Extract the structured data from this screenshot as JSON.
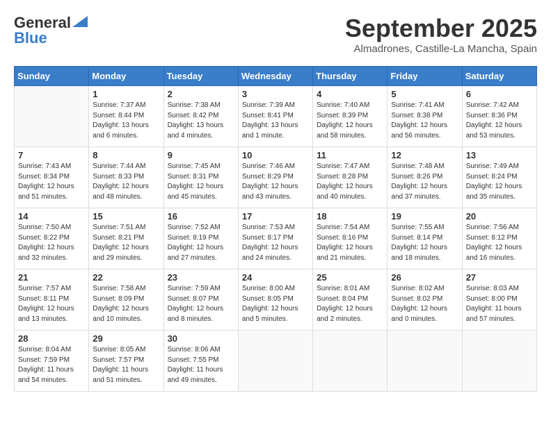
{
  "header": {
    "logo_line1": "General",
    "logo_line2": "Blue",
    "month": "September 2025",
    "location": "Almadrones, Castille-La Mancha, Spain"
  },
  "weekdays": [
    "Sunday",
    "Monday",
    "Tuesday",
    "Wednesday",
    "Thursday",
    "Friday",
    "Saturday"
  ],
  "weeks": [
    [
      {
        "day": "",
        "info": ""
      },
      {
        "day": "1",
        "info": "Sunrise: 7:37 AM\nSunset: 8:44 PM\nDaylight: 13 hours\nand 6 minutes."
      },
      {
        "day": "2",
        "info": "Sunrise: 7:38 AM\nSunset: 8:42 PM\nDaylight: 13 hours\nand 4 minutes."
      },
      {
        "day": "3",
        "info": "Sunrise: 7:39 AM\nSunset: 8:41 PM\nDaylight: 13 hours\nand 1 minute."
      },
      {
        "day": "4",
        "info": "Sunrise: 7:40 AM\nSunset: 8:39 PM\nDaylight: 12 hours\nand 58 minutes."
      },
      {
        "day": "5",
        "info": "Sunrise: 7:41 AM\nSunset: 8:38 PM\nDaylight: 12 hours\nand 56 minutes."
      },
      {
        "day": "6",
        "info": "Sunrise: 7:42 AM\nSunset: 8:36 PM\nDaylight: 12 hours\nand 53 minutes."
      }
    ],
    [
      {
        "day": "7",
        "info": "Sunrise: 7:43 AM\nSunset: 8:34 PM\nDaylight: 12 hours\nand 51 minutes."
      },
      {
        "day": "8",
        "info": "Sunrise: 7:44 AM\nSunset: 8:33 PM\nDaylight: 12 hours\nand 48 minutes."
      },
      {
        "day": "9",
        "info": "Sunrise: 7:45 AM\nSunset: 8:31 PM\nDaylight: 12 hours\nand 45 minutes."
      },
      {
        "day": "10",
        "info": "Sunrise: 7:46 AM\nSunset: 8:29 PM\nDaylight: 12 hours\nand 43 minutes."
      },
      {
        "day": "11",
        "info": "Sunrise: 7:47 AM\nSunset: 8:28 PM\nDaylight: 12 hours\nand 40 minutes."
      },
      {
        "day": "12",
        "info": "Sunrise: 7:48 AM\nSunset: 8:26 PM\nDaylight: 12 hours\nand 37 minutes."
      },
      {
        "day": "13",
        "info": "Sunrise: 7:49 AM\nSunset: 8:24 PM\nDaylight: 12 hours\nand 35 minutes."
      }
    ],
    [
      {
        "day": "14",
        "info": "Sunrise: 7:50 AM\nSunset: 8:22 PM\nDaylight: 12 hours\nand 32 minutes."
      },
      {
        "day": "15",
        "info": "Sunrise: 7:51 AM\nSunset: 8:21 PM\nDaylight: 12 hours\nand 29 minutes."
      },
      {
        "day": "16",
        "info": "Sunrise: 7:52 AM\nSunset: 8:19 PM\nDaylight: 12 hours\nand 27 minutes."
      },
      {
        "day": "17",
        "info": "Sunrise: 7:53 AM\nSunset: 8:17 PM\nDaylight: 12 hours\nand 24 minutes."
      },
      {
        "day": "18",
        "info": "Sunrise: 7:54 AM\nSunset: 8:16 PM\nDaylight: 12 hours\nand 21 minutes."
      },
      {
        "day": "19",
        "info": "Sunrise: 7:55 AM\nSunset: 8:14 PM\nDaylight: 12 hours\nand 18 minutes."
      },
      {
        "day": "20",
        "info": "Sunrise: 7:56 AM\nSunset: 8:12 PM\nDaylight: 12 hours\nand 16 minutes."
      }
    ],
    [
      {
        "day": "21",
        "info": "Sunrise: 7:57 AM\nSunset: 8:11 PM\nDaylight: 12 hours\nand 13 minutes."
      },
      {
        "day": "22",
        "info": "Sunrise: 7:58 AM\nSunset: 8:09 PM\nDaylight: 12 hours\nand 10 minutes."
      },
      {
        "day": "23",
        "info": "Sunrise: 7:59 AM\nSunset: 8:07 PM\nDaylight: 12 hours\nand 8 minutes."
      },
      {
        "day": "24",
        "info": "Sunrise: 8:00 AM\nSunset: 8:05 PM\nDaylight: 12 hours\nand 5 minutes."
      },
      {
        "day": "25",
        "info": "Sunrise: 8:01 AM\nSunset: 8:04 PM\nDaylight: 12 hours\nand 2 minutes."
      },
      {
        "day": "26",
        "info": "Sunrise: 8:02 AM\nSunset: 8:02 PM\nDaylight: 12 hours\nand 0 minutes."
      },
      {
        "day": "27",
        "info": "Sunrise: 8:03 AM\nSunset: 8:00 PM\nDaylight: 11 hours\nand 57 minutes."
      }
    ],
    [
      {
        "day": "28",
        "info": "Sunrise: 8:04 AM\nSunset: 7:59 PM\nDaylight: 11 hours\nand 54 minutes."
      },
      {
        "day": "29",
        "info": "Sunrise: 8:05 AM\nSunset: 7:57 PM\nDaylight: 11 hours\nand 51 minutes."
      },
      {
        "day": "30",
        "info": "Sunrise: 8:06 AM\nSunset: 7:55 PM\nDaylight: 11 hours\nand 49 minutes."
      },
      {
        "day": "",
        "info": ""
      },
      {
        "day": "",
        "info": ""
      },
      {
        "day": "",
        "info": ""
      },
      {
        "day": "",
        "info": ""
      }
    ]
  ]
}
